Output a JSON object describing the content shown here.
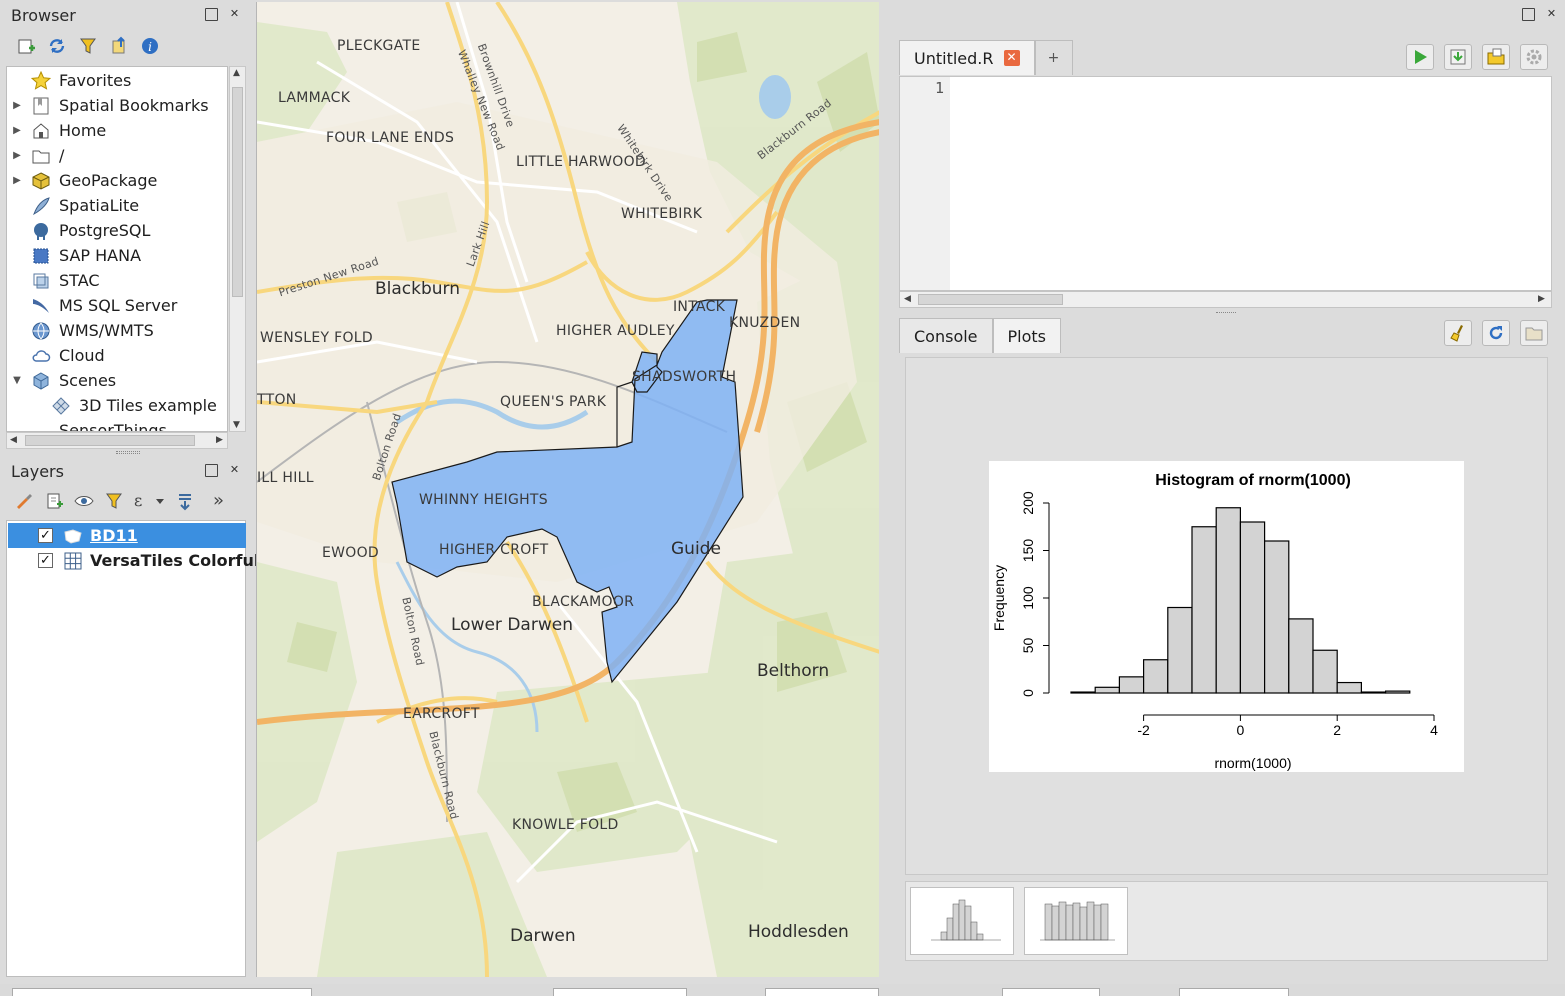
{
  "browser": {
    "title": "Browser",
    "items": [
      {
        "label": "Favorites",
        "arrow": ""
      },
      {
        "label": "Spatial Bookmarks",
        "arrow": "▶"
      },
      {
        "label": "Home",
        "arrow": "▶"
      },
      {
        "label": "/",
        "arrow": "▶"
      },
      {
        "label": "GeoPackage",
        "arrow": "▶"
      },
      {
        "label": "SpatiaLite",
        "arrow": ""
      },
      {
        "label": "PostgreSQL",
        "arrow": ""
      },
      {
        "label": "SAP HANA",
        "arrow": ""
      },
      {
        "label": "STAC",
        "arrow": ""
      },
      {
        "label": "MS SQL Server",
        "arrow": ""
      },
      {
        "label": "WMS/WMTS",
        "arrow": ""
      },
      {
        "label": "Cloud",
        "arrow": ""
      },
      {
        "label": "Scenes",
        "arrow": "▼"
      },
      {
        "label": "3D Tiles example",
        "arrow": ""
      },
      {
        "label": "SensorThings",
        "arrow": ""
      }
    ]
  },
  "layers": {
    "title": "Layers",
    "items": [
      {
        "label": "BD11",
        "checked": "✓"
      },
      {
        "label": "VersaTiles Colorful",
        "checked": "✓"
      }
    ]
  },
  "map": {
    "places": [
      {
        "text": "PLECKGATE"
      },
      {
        "text": "LAMMACK"
      },
      {
        "text": "FOUR LANE ENDS"
      },
      {
        "text": "LITTLE HARWOOD"
      },
      {
        "text": "WHITEBIRK"
      },
      {
        "text": "Blackburn"
      },
      {
        "text": "INTACK"
      },
      {
        "text": "KNUZDEN"
      },
      {
        "text": "WENSLEY FOLD"
      },
      {
        "text": "HIGHER AUDLEY"
      },
      {
        "text": "SHADSWORTH"
      },
      {
        "text": "TTON"
      },
      {
        "text": "QUEEN'S PARK"
      },
      {
        "text": "ILL HILL"
      },
      {
        "text": "WHINNY HEIGHTS"
      },
      {
        "text": "Guide"
      },
      {
        "text": "EWOOD"
      },
      {
        "text": "HIGHER CROFT"
      },
      {
        "text": "BLACKAMOOR"
      },
      {
        "text": "Lower Darwen"
      },
      {
        "text": "Belthorn"
      },
      {
        "text": "EARCROFT"
      },
      {
        "text": "KNOWLE FOLD"
      },
      {
        "text": "Darwen"
      },
      {
        "text": "Hoddlesden"
      }
    ],
    "roads": [
      {
        "text": "Brownhill Drive"
      },
      {
        "text": "Whalley New Road"
      },
      {
        "text": "Whitebirk Drive"
      },
      {
        "text": "Blackburn Road"
      },
      {
        "text": "Lark Hill"
      },
      {
        "text": "Preston New Road"
      },
      {
        "text": "Bolton Road"
      },
      {
        "text": "Bolton Road"
      },
      {
        "text": "Blackburn Road"
      }
    ]
  },
  "editor": {
    "tab_label": "Untitled.R",
    "tab_close": "✕",
    "new_tab": "+",
    "line_numbers": [
      "1"
    ]
  },
  "console_tabs": [
    {
      "label": "Console"
    },
    {
      "label": "Plots"
    }
  ],
  "chart_data": {
    "type": "bar",
    "title": "Histogram of rnorm(1000)",
    "xlabel": "rnorm(1000)",
    "ylabel": "Frequency",
    "bin_edges": [
      -3.5,
      -3,
      -2.5,
      -2,
      -1.5,
      -1,
      -0.5,
      0,
      0.5,
      1,
      1.5,
      2,
      2.5,
      3,
      3.5
    ],
    "values": [
      1,
      6,
      17,
      35,
      90,
      175,
      195,
      180,
      160,
      78,
      45,
      11,
      1,
      2
    ],
    "xlim": [
      -3.5,
      4
    ],
    "ylim": [
      0,
      200
    ],
    "x_ticks": [
      "-2",
      "0",
      "2",
      "4"
    ],
    "x_tick_values": [
      -2,
      0,
      2,
      4
    ],
    "y_ticks": [
      "0",
      "50",
      "100",
      "150",
      "200"
    ],
    "y_tick_values": [
      0,
      50,
      100,
      150,
      200
    ],
    "grid": false,
    "colors": {
      "bar": "#d3d3d3",
      "stroke": "#000000"
    }
  },
  "colors": {
    "selection": "#3b8fe0",
    "polygon_fill": "#7fb1f5",
    "run_icon": "#3aa83a",
    "close_tab": "#e9693f"
  }
}
